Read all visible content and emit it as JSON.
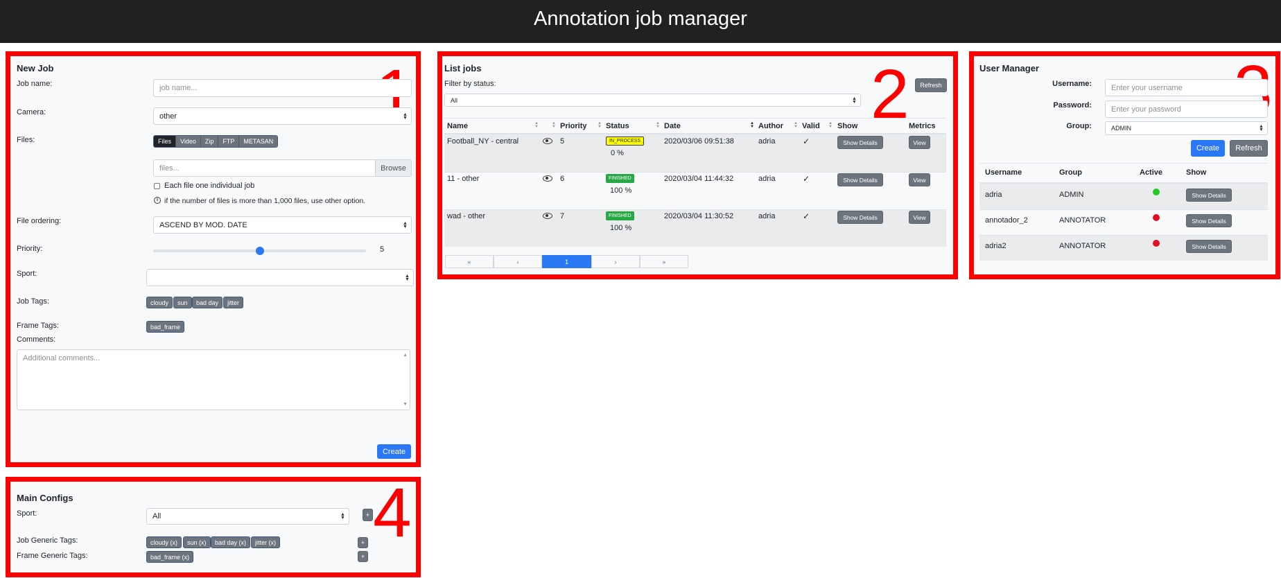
{
  "app_title": "Annotation job manager",
  "panel_numbers": {
    "p1": "1",
    "p2": "2",
    "p3": "3",
    "p4": "4"
  },
  "new_job": {
    "title": "New Job",
    "job_name_label": "Job name:",
    "job_name_placeholder": "job name...",
    "camera_label": "Camera:",
    "camera_value": "other",
    "files_label": "Files:",
    "files_tabs": [
      "Files",
      "Video",
      "Zip",
      "FTP",
      "METASAN"
    ],
    "files_placeholder": "files...",
    "browse_label": "Browse",
    "each_file_label": "Each file one individual job",
    "info_text": "if the number of files is more than 1,000 files, use other option.",
    "file_ordering_label": "File ordering:",
    "file_ordering_value": "ASCEND BY MOD. DATE",
    "priority_label": "Priority:",
    "priority_value": "5",
    "priority_fraction": 0.5,
    "sport_label": "Sport:",
    "sport_value": "",
    "job_tags_label": "Job Tags:",
    "job_tags": [
      "cloudy",
      "sun",
      "bad day",
      "jitter"
    ],
    "frame_tags_label": "Frame Tags:",
    "frame_tags": [
      "bad_frame"
    ],
    "comments_label": "Comments:",
    "comments_placeholder": "Additional comments...",
    "create_label": "Create"
  },
  "list_jobs": {
    "title": "List jobs",
    "filter_label": "Filter by status:",
    "filter_value": "All",
    "refresh_label": "Refresh",
    "columns": [
      "Name",
      "Priority",
      "Status",
      "Date",
      "Author",
      "Valid",
      "Show",
      "Metrics"
    ],
    "rows": [
      {
        "name": "Football_NY - central",
        "priority": "5",
        "status": "IN_PROCESS",
        "progress": "0 %",
        "date": "2020/03/06 09:51:38",
        "author": "adria",
        "show": "Show Details",
        "metrics": "View"
      },
      {
        "name": "11 - other",
        "priority": "6",
        "status": "FINISHED",
        "progress": "100 %",
        "date": "2020/03/04 11:44:32",
        "author": "adria",
        "show": "Show Details",
        "metrics": "View"
      },
      {
        "name": "wad - other",
        "priority": "7",
        "status": "FINISHED",
        "progress": "100 %",
        "date": "2020/03/04 11:30:52",
        "author": "adria",
        "show": "Show Details",
        "metrics": "View"
      }
    ],
    "status_colors": {
      "IN_PROCESS": "#ffff00",
      "FINISHED": "#28a745"
    },
    "pagination": [
      "«",
      "‹",
      "1",
      "›",
      "»"
    ]
  },
  "user_manager": {
    "title": "User Manager",
    "username_label": "Username:",
    "username_placeholder": "Enter your username",
    "password_label": "Password:",
    "password_placeholder": "Enter your password",
    "group_label": "Group:",
    "group_value": "ADMIN",
    "create_label": "Create",
    "refresh_label": "Refresh",
    "columns": [
      "Username",
      "Group",
      "Active",
      "Show"
    ],
    "rows": [
      {
        "username": "adria",
        "group": "ADMIN",
        "active": true,
        "show": "Show Details"
      },
      {
        "username": "annotador_2",
        "group": "ANNOTATOR",
        "active": false,
        "show": "Show Details"
      },
      {
        "username": "adria2",
        "group": "ANNOTATOR",
        "active": false,
        "show": "Show Details"
      }
    ],
    "active_color": "#22cc22",
    "inactive_color": "#dd1122"
  },
  "main_configs": {
    "title": "Main Configs",
    "sport_label": "Sport:",
    "sport_value": "All",
    "plus": "+",
    "job_generic_label": "Job Generic Tags:",
    "job_generic_tags": [
      "cloudy (x)",
      "sun (x)",
      "bad day (x)",
      "jitter (x)"
    ],
    "frame_generic_label": "Frame Generic Tags:",
    "frame_generic_tags": [
      "bad_frame (x)"
    ]
  }
}
